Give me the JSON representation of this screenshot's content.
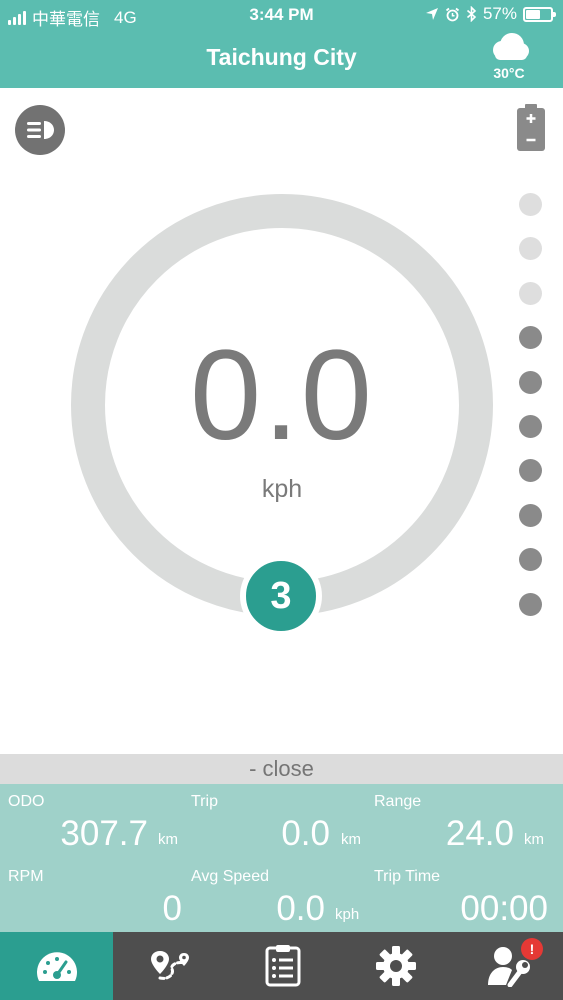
{
  "status_bar": {
    "carrier": "中華電信",
    "network": "4G",
    "time": "3:44 PM",
    "battery_percent": "57%",
    "battery_level": 0.57
  },
  "header": {
    "city": "Taichung City",
    "temperature": "30°C",
    "weather_icon": "cloud-icon"
  },
  "dashboard": {
    "speed": "0.0",
    "speed_unit": "kph",
    "assist_level": "3",
    "assist_dots": [
      false,
      false,
      false,
      true,
      true,
      true,
      true,
      true,
      true,
      true
    ]
  },
  "panel": {
    "close_label": "- close",
    "odo": {
      "label": "ODO",
      "value": "307.7",
      "unit": "km"
    },
    "trip": {
      "label": "Trip",
      "value": "0.0",
      "unit": "km"
    },
    "range": {
      "label": "Range",
      "value": "24.0",
      "unit": "km"
    },
    "rpm": {
      "label": "RPM",
      "value": "0"
    },
    "avg_speed": {
      "label": "Avg Speed",
      "value": "0.0",
      "unit": "kph"
    },
    "trip_time": {
      "label": "Trip Time",
      "value": "00:00"
    }
  },
  "nav": {
    "items": [
      {
        "name": "dashboard",
        "icon": "speedometer-icon",
        "active": true
      },
      {
        "name": "route",
        "icon": "map-route-icon",
        "active": false
      },
      {
        "name": "records",
        "icon": "list-document-icon",
        "active": false
      },
      {
        "name": "settings",
        "icon": "gear-icon",
        "active": false
      },
      {
        "name": "service",
        "icon": "user-wrench-icon",
        "active": false,
        "badge": "!"
      }
    ]
  },
  "colors": {
    "accent": "#2b9e90",
    "header": "#5bbdb0",
    "panel": "#9fd1c9",
    "nav": "#4e4e4e",
    "alert": "#e53935"
  }
}
